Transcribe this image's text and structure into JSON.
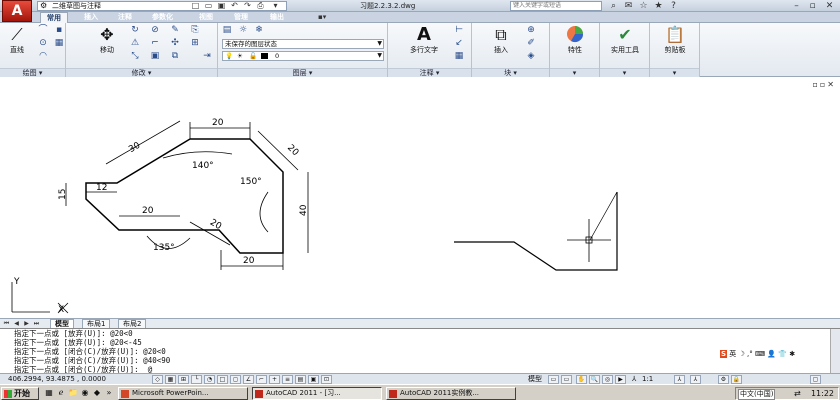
{
  "window": {
    "workspace": "二维草图与注释",
    "document_title": "习题2.2.3.2.dwg",
    "help_search_placeholder": "键入关键字或短语"
  },
  "ribbon_tabs": [
    "常用",
    "插入",
    "注释",
    "参数化",
    "视图",
    "管理",
    "输出"
  ],
  "ribbon": {
    "draw": {
      "line_label": "直线",
      "panel_label": "绘图"
    },
    "modify": {
      "move_label": "移动",
      "panel_label": "修改"
    },
    "layers": {
      "state": "未保存的图层状态",
      "current_layer": "0",
      "panel_label": "图层"
    },
    "annotation": {
      "mtext_label": "多行文字",
      "panel_label": "注释"
    },
    "block": {
      "insert_label": "插入",
      "panel_label": "块"
    },
    "properties": {
      "label": "特性"
    },
    "utilities": {
      "label": "实用工具"
    },
    "clipboard": {
      "label": "剪贴板"
    }
  },
  "drawing": {
    "dims": [
      "20",
      "30",
      "20",
      "15",
      "12",
      "20",
      "20",
      "20",
      "40",
      "140°",
      "150°",
      "135°"
    ],
    "ucs_x": "X",
    "ucs_y": "Y"
  },
  "layout_tabs": [
    "模型",
    "布局1",
    "布局2"
  ],
  "command_lines": [
    "指定下一点或 [放弃(U)]: @20<0",
    "指定下一点或 [放弃(U)]: @20<-45",
    "指定下一点或 [闭合(C)/放弃(U)]: @20<0",
    "指定下一点或 [闭合(C)/放弃(U)]: @40<90",
    "指定下一点或 [闭合(C)/放弃(U)]:  @"
  ],
  "ime": {
    "brand": "S",
    "lang": "英"
  },
  "status": {
    "coords": "406.2994, 93.4875 , 0.0000",
    "model_label": "模型",
    "scale": "1:1"
  },
  "taskbar": {
    "start": "开始",
    "tasks": [
      "Microsoft PowerPoin...",
      "AutoCAD 2011 - [习...",
      "AutoCAD 2011实例教..."
    ],
    "ime_lang": "中文(中国)",
    "clock": "11:22"
  },
  "colors": {
    "titlebar": "#c5d0de",
    "ribbon": "#e3e9f0",
    "accent": "#1f3b66"
  }
}
